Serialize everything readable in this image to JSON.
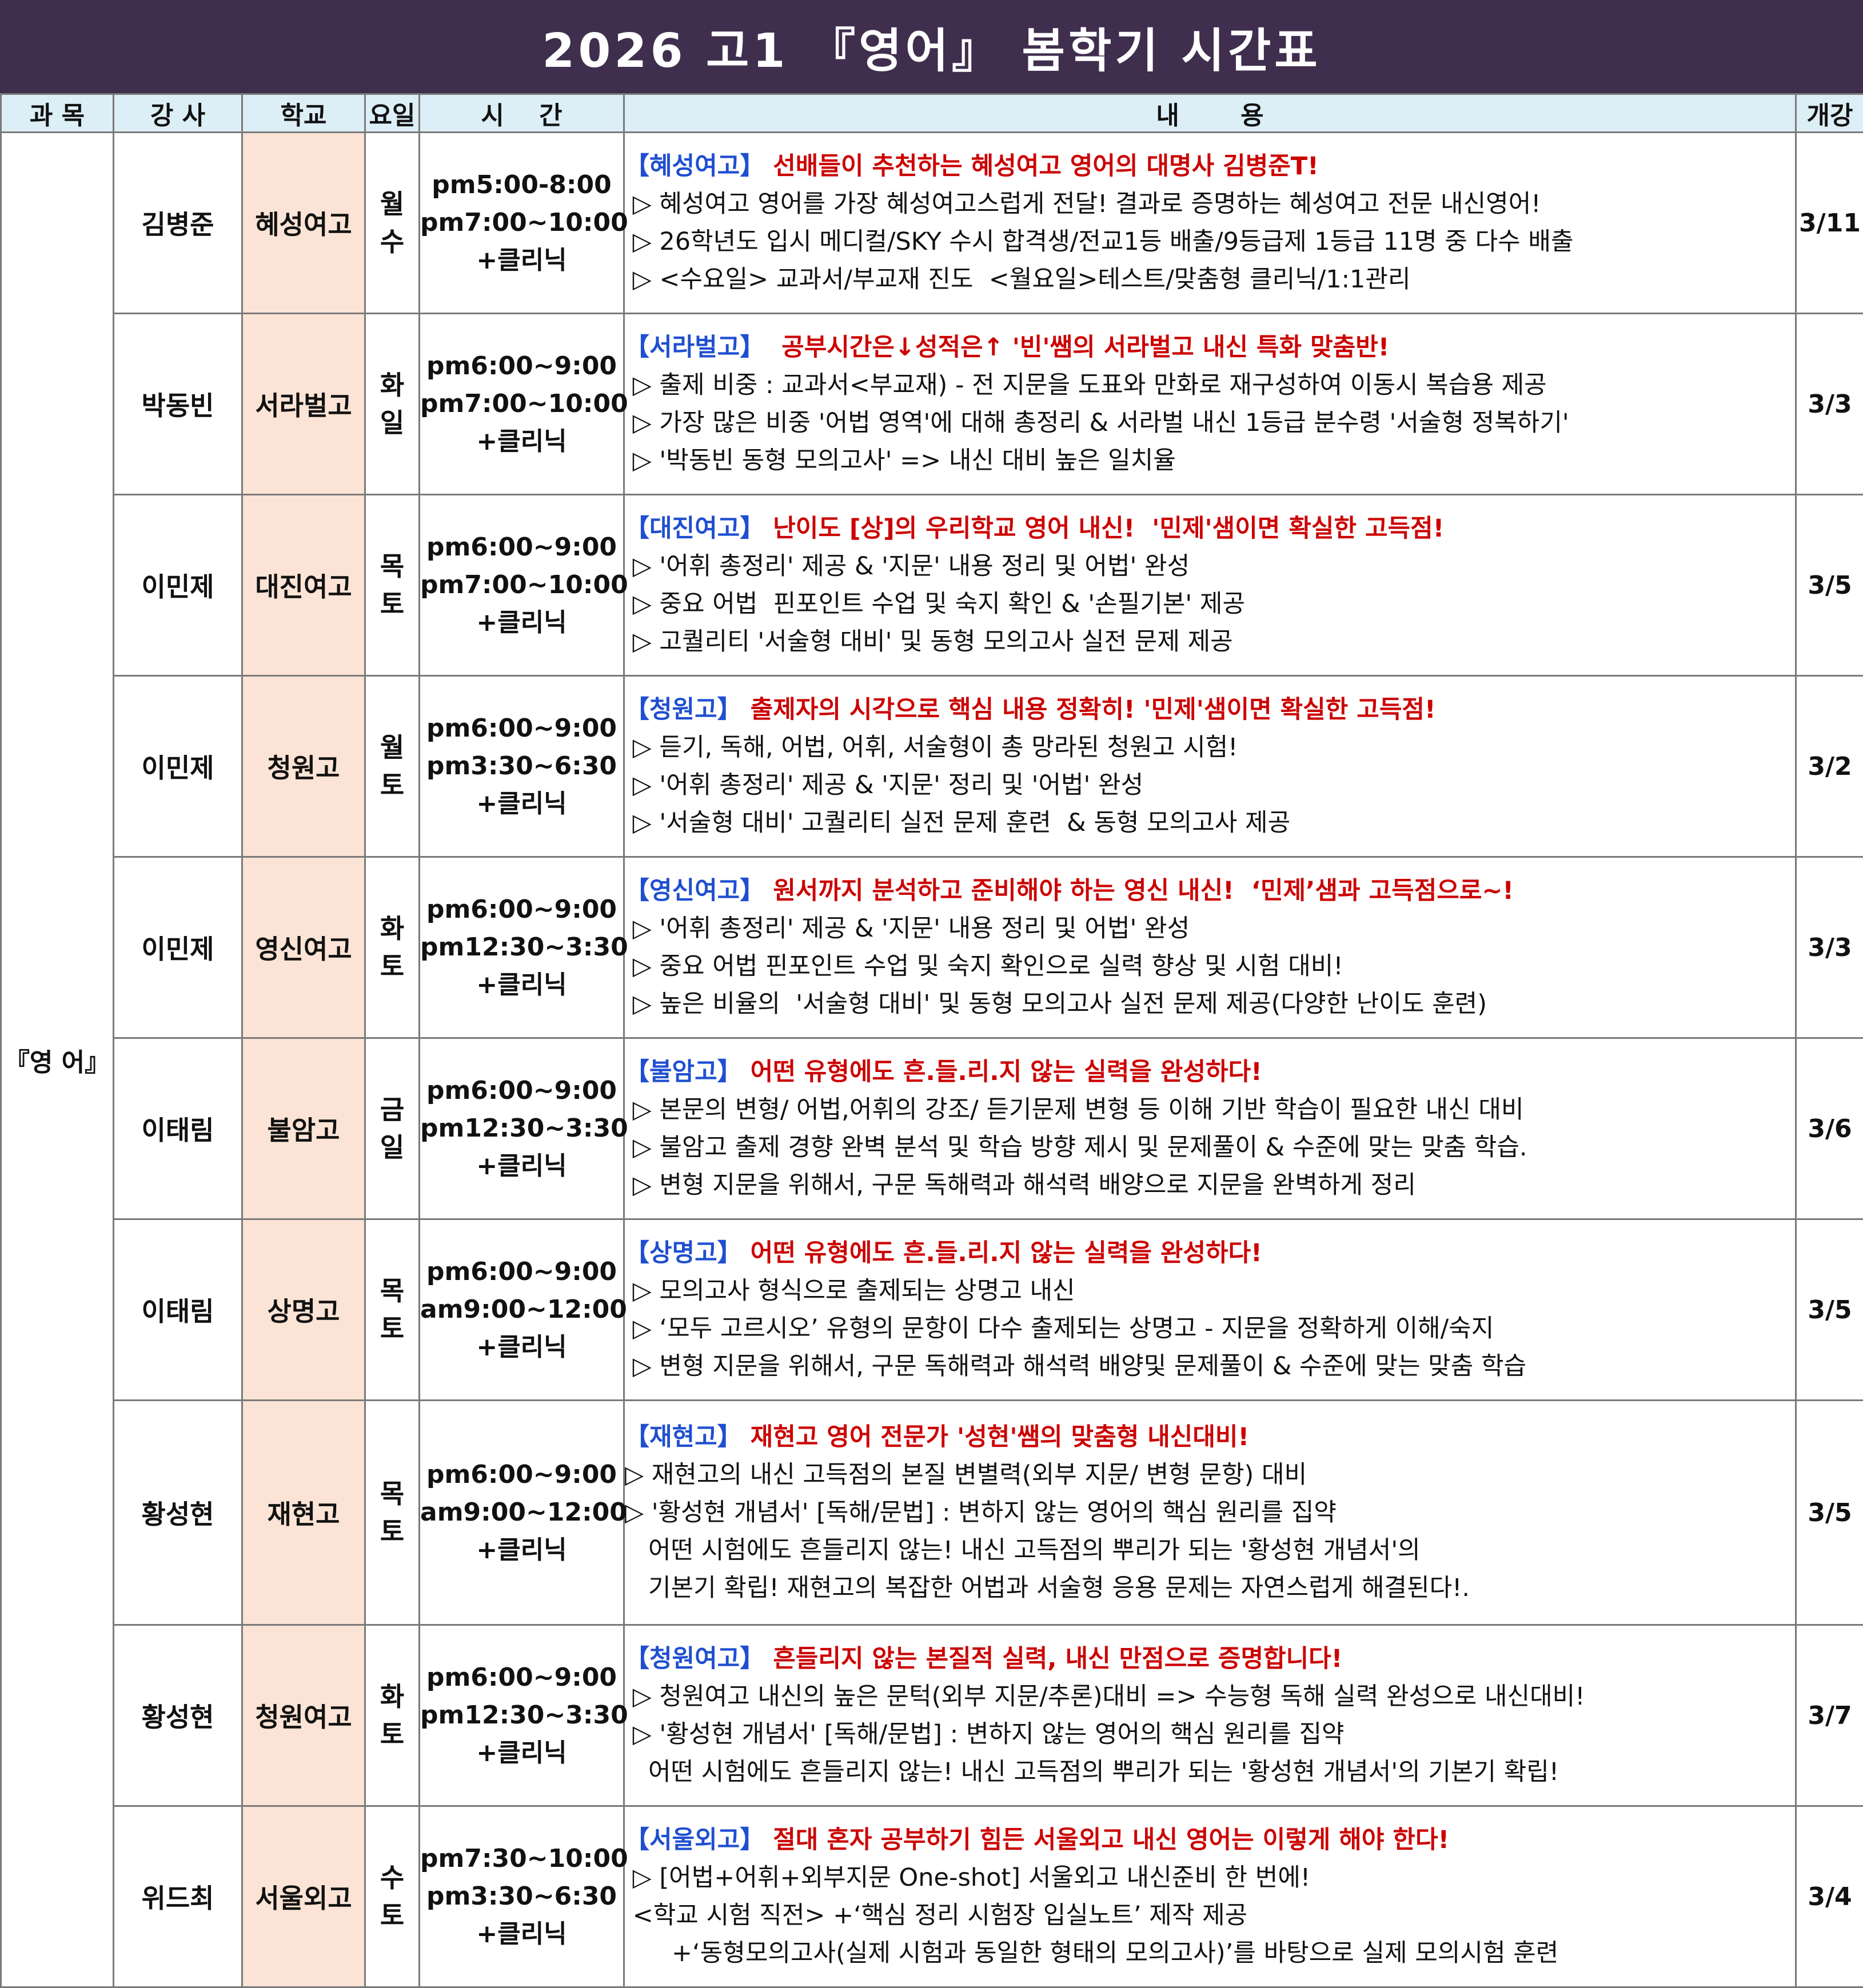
{
  "title": "2026 고1 『영어』 봄학기 시간표",
  "headers": [
    "과 목",
    "강 사",
    "학교",
    "요일",
    "시    간",
    "내       용",
    "개강"
  ],
  "subject": "『영 어』",
  "rows": [
    {
      "teacher": "김병준",
      "school": "혜성여고",
      "days": [
        "월",
        "수"
      ],
      "times": [
        "pm5:00-8:00",
        "pm7:00~10:00",
        "+클리닉"
      ],
      "tag": "【혜성여고】",
      "headline": " 선배들이 추천하는 혜성여고 영어의 대명사 김병준T!",
      "lines": [
        " ▷ 혜성여고 영어를 가장 혜성여고스럽게 전달! 결과로 증명하는 혜성여고 전문 내신영어!",
        " ▷ 26학년도 입시 메디컬/SKY 수시 합격생/전교1등 배출/9등급제 1등급 11명 중 다수 배출",
        " ▷ <수요일> 교과서/부교재 진도  <월요일>테스트/맞춤형 클리닉/1:1관리"
      ],
      "start": "3/11"
    },
    {
      "teacher": "박동빈",
      "school": "서라벌고",
      "days": [
        "화",
        "일"
      ],
      "times": [
        "pm6:00~9:00",
        "pm7:00~10:00",
        "+클리닉"
      ],
      "tag": "【서라벌고】",
      "headline": "  공부시간은↓성적은↑ '빈'쌤의 서라벌고 내신 특화 맞춤반!",
      "lines": [
        " ▷ 출제 비중 : 교과서<부교재) - 전 지문을 도표와 만화로 재구성하여 이동시 복습용 제공",
        " ▷ 가장 많은 비중 '어법 영역'에 대해 총정리 & 서라벌 내신 1등급 분수령 '서술형 정복하기'",
        " ▷ '박동빈 동형 모의고사' => 내신 대비 높은 일치율"
      ],
      "start": "3/3"
    },
    {
      "teacher": "이민제",
      "school": "대진여고",
      "days": [
        "목",
        "토"
      ],
      "times": [
        "pm6:00~9:00",
        "pm7:00~10:00",
        "+클리닉"
      ],
      "tag": "【대진여고】",
      "headline": " 난이도 [상]의 우리학교 영어 내신!  '민제'샘이면 확실한 고득점!",
      "lines": [
        " ▷ '어휘 총정리' 제공 & '지문' 내용 정리 및 어법' 완성",
        " ▷ 중요 어법  핀포인트 수업 및 숙지 확인 & '손필기본' 제공",
        " ▷ 고퀄리티 '서술형 대비' 및 동형 모의고사 실전 문제 제공"
      ],
      "start": "3/5"
    },
    {
      "teacher": "이민제",
      "school": "청원고",
      "days": [
        "월",
        "토"
      ],
      "times": [
        "pm6:00~9:00",
        "pm3:30~6:30",
        "+클리닉"
      ],
      "tag": "【청원고】",
      "headline": " 출제자의 시각으로 핵심 내용 정확히! '민제'샘이면 확실한 고득점!",
      "lines": [
        " ▷ 듣기, 독해, 어법, 어휘, 서술형이 총 망라된 청원고 시험!",
        " ▷ '어휘 총정리' 제공 & '지문' 정리 및 '어법' 완성",
        " ▷ '서술형 대비' 고퀄리티 실전 문제 훈련  & 동형 모의고사 제공"
      ],
      "start": "3/2"
    },
    {
      "teacher": "이민제",
      "school": "영신여고",
      "days": [
        "화",
        "토"
      ],
      "times": [
        "pm6:00~9:00",
        "pm12:30~3:30",
        "+클리닉"
      ],
      "tag": "【영신여고】",
      "headline": " 원서까지 분석하고 준비해야 하는 영신 내신!  ‘민제’샘과 고득점으로~!",
      "lines": [
        " ▷ '어휘 총정리' 제공 & '지문' 내용 정리 및 어법' 완성",
        " ▷ 중요 어법 핀포인트 수업 및 숙지 확인으로 실력 향상 및 시험 대비!",
        " ▷ 높은 비율의  '서술형 대비' 및 동형 모의고사 실전 문제 제공(다양한 난이도 훈련)"
      ],
      "start": "3/3"
    },
    {
      "teacher": "이태림",
      "school": "불암고",
      "days": [
        "금",
        "일"
      ],
      "times": [
        "pm6:00~9:00",
        "pm12:30~3:30",
        "+클리닉"
      ],
      "tag": "【불암고】",
      "headline": " 어떤 유형에도 흔.들.리.지 않는 실력을 완성하다!",
      "lines": [
        " ▷ 본문의 변형/ 어법,어휘의 강조/ 듣기문제 변형 등 이해 기반 학습이 필요한 내신 대비",
        " ▷ 불암고 출제 경향 완벽 분석 및 학습 방향 제시 및 문제풀이 & 수준에 맞는 맞춤 학습.",
        " ▷ 변형 지문을 위해서, 구문 독해력과 해석력 배양으로 지문을 완벽하게 정리"
      ],
      "start": "3/6"
    },
    {
      "teacher": "이태림",
      "school": "상명고",
      "days": [
        "목",
        "토"
      ],
      "times": [
        "pm6:00~9:00",
        "am9:00~12:00",
        "+클리닉"
      ],
      "tag": "【상명고】",
      "headline": " 어떤 유형에도 흔.들.리.지 않는 실력을 완성하다!",
      "lines": [
        " ▷ 모의고사 형식으로 출제되는 상명고 내신",
        " ▷ ‘모두 고르시오’ 유형의 문항이 다수 출제되는 상명고 - 지문을 정확하게 이해/숙지",
        " ▷ 변형 지문을 위해서, 구문 독해력과 해석력 배양및 문제풀이 & 수준에 맞는 맞춤 학습"
      ],
      "start": "3/5"
    },
    {
      "teacher": "황성현",
      "school": "재현고",
      "days": [
        "목",
        "토"
      ],
      "times": [
        "pm6:00~9:00",
        "am9:00~12:00",
        "+클리닉"
      ],
      "tag": "【재현고】",
      "headline": " 재현고 영어 전문가 '성현'쌤의 맞춤형 내신대비!",
      "lines": [
        "▷ 재현고의 내신 고득점의 본질 변별력(외부 지문/ 변형 문항) 대비",
        "▷ '황성현 개념서' [독해/문법] : 변하지 않는 영어의 핵심 원리를 집약",
        "   어떤 시험에도 흔들리지 않는! 내신 고득점의 뿌리가 되는 '황성현 개념서'의",
        "   기본기 확립! 재현고의 복잡한 어법과 서술형 응용 문제는 자연스럽게 해결된다!."
      ],
      "start": "3/5"
    },
    {
      "teacher": "황성현",
      "school": "청원여고",
      "days": [
        "화",
        "토"
      ],
      "times": [
        "pm6:00~9:00",
        "pm12:30~3:30",
        "+클리닉"
      ],
      "tag": "【청원여고】",
      "headline": " 흔들리지 않는 본질적 실력, 내신 만점으로 증명합니다!",
      "lines": [
        " ▷ 청원여고 내신의 높은 문턱(외부 지문/추론)대비 => 수능형 독해 실력 완성으로 내신대비!",
        " ▷ '황성현 개념서' [독해/문법] : 변하지 않는 영어의 핵심 원리를 집약",
        "   어떤 시험에도 흔들리지 않는! 내신 고득점의 뿌리가 되는 '황성현 개념서'의 기본기 확립!"
      ],
      "start": "3/7"
    },
    {
      "teacher": "위드최",
      "school": "서울외고",
      "days": [
        "수",
        "토"
      ],
      "times": [
        "pm7:30~10:00",
        "pm3:30~6:30",
        "+클리닉"
      ],
      "tag": "【서울외고】",
      "headline": " 절대 혼자 공부하기 힘든 서울외고 내신 영어는 이렇게 해야 한다!",
      "lines": [
        " ▷ [어법+어휘+외부지문 One-shot] 서울외고 내신준비 한 번에!",
        " <학교 시험 직전> +‘핵심 정리 시험장 입실노트’ 제작 제공",
        "      +‘동형모의고사(실제 시험과 동일한 형태의 모의고사)’를 바탕으로 실제 모의시험 훈련"
      ],
      "start": "3/4"
    }
  ]
}
